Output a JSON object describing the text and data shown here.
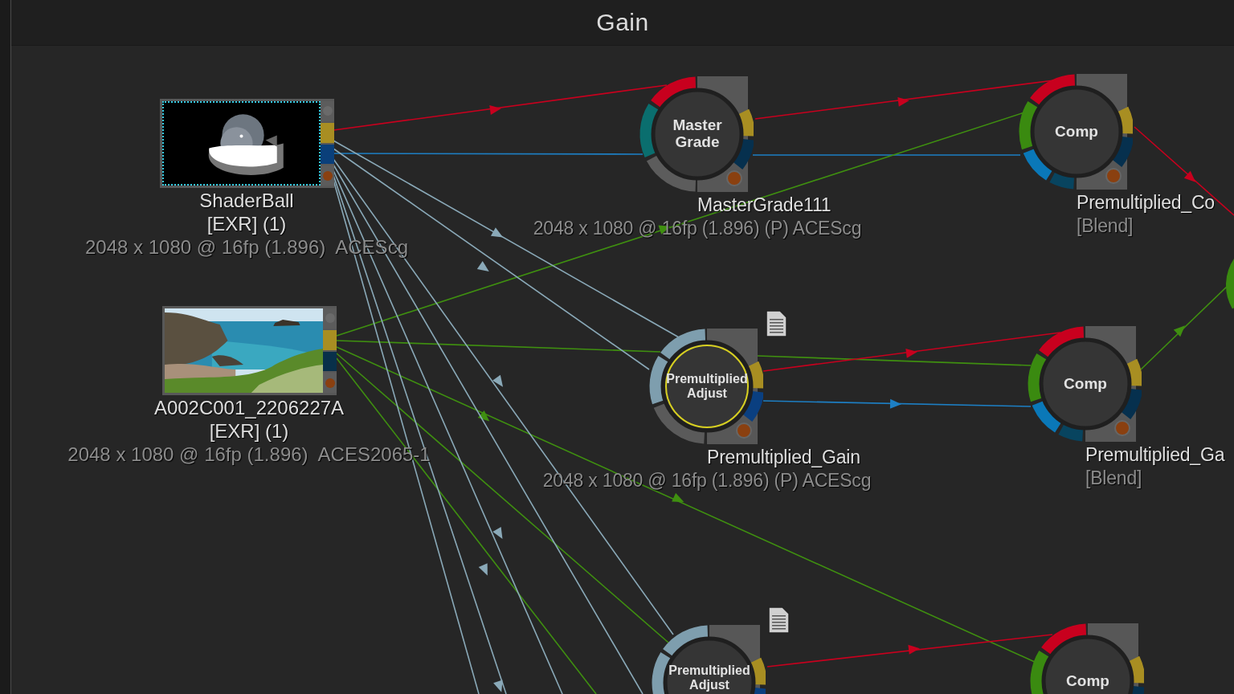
{
  "title": "Gain",
  "sources": [
    {
      "name": "ShaderBall",
      "format": "[EXR] (1)",
      "info": "2048 x 1080 @ 16fp (1.896)  ACEScg",
      "selected": true
    },
    {
      "name": "A002C001_2206227A",
      "format": "[EXR] (1)",
      "info": "2048 x 1080 @ 16fp (1.896)  ACES2065-1",
      "selected": false
    }
  ],
  "nodes": [
    {
      "kind": "grade",
      "label": "Master Grade",
      "name": "MasterGrade111",
      "info": "2048 x 1080 @ 16fp (1.896) (P) ACEScg",
      "selected": false,
      "note": false
    },
    {
      "kind": "comp",
      "label": "Comp",
      "name": "Premultiplied_Co",
      "subtitle": "[Blend]",
      "selected": false,
      "note": false
    },
    {
      "kind": "adjust",
      "label": "Premultiplied Adjust",
      "name": "Premultiplied_Gain",
      "info": "2048 x 1080 @ 16fp (1.896) (P) ACEScg",
      "selected": true,
      "note": true
    },
    {
      "kind": "comp",
      "label": "Comp",
      "name": "Premultiplied_Ga",
      "subtitle": "[Blend]",
      "selected": false,
      "note": false
    },
    {
      "kind": "adjust",
      "label": "Premultiplied Adjust",
      "selected": false,
      "note": true
    },
    {
      "kind": "comp",
      "label": "Comp",
      "selected": false,
      "note": false
    }
  ]
}
